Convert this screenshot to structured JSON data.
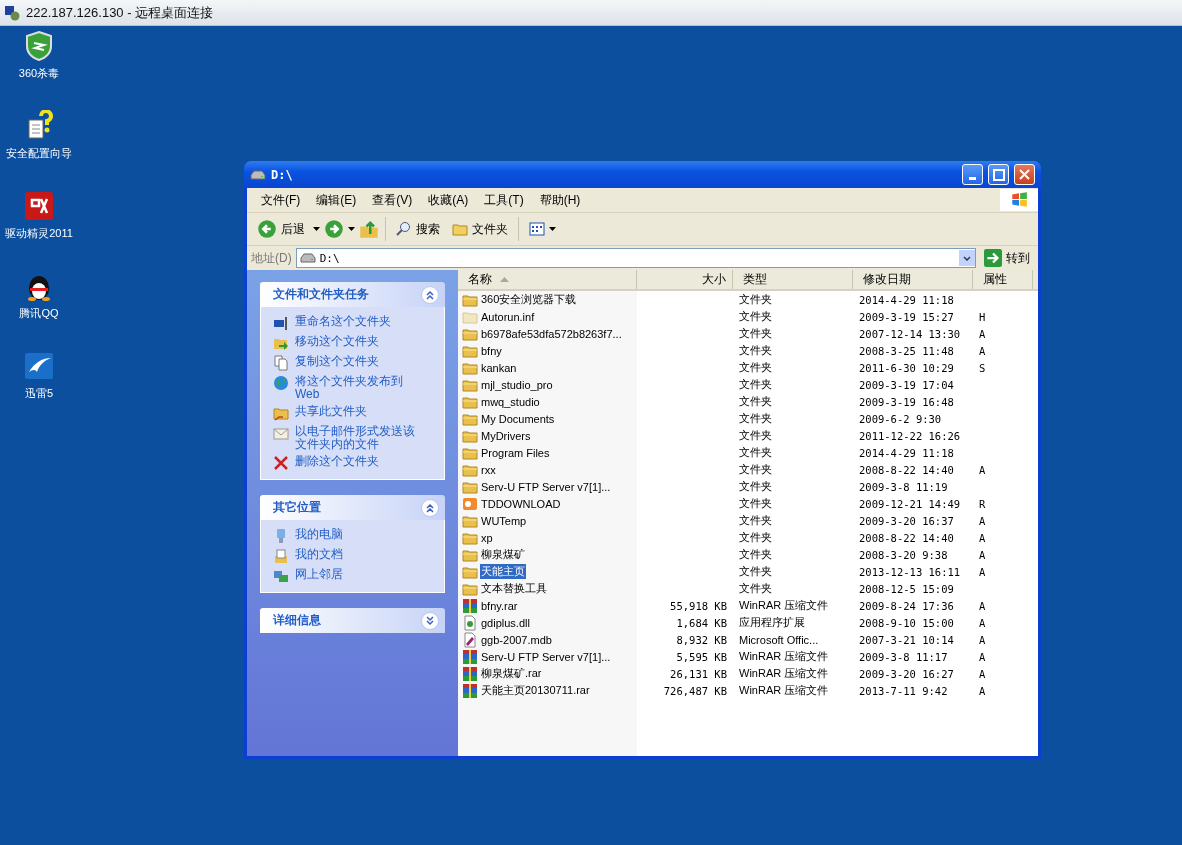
{
  "rdp_title": "222.187.126.130 - 远程桌面连接",
  "desktop_icons": [
    {
      "label": "360杀毒",
      "kind": "shield"
    },
    {
      "label": "安全配置向导",
      "kind": "help"
    },
    {
      "label": "驱动精灵2011",
      "kind": "driver"
    },
    {
      "label": "腾讯QQ",
      "kind": "penguin"
    },
    {
      "label": "迅雷5",
      "kind": "bird"
    }
  ],
  "window": {
    "title": "D:\\",
    "menu": [
      "文件(F)",
      "编辑(E)",
      "查看(V)",
      "收藏(A)",
      "工具(T)",
      "帮助(H)"
    ],
    "toolbar": {
      "back": "后退",
      "search": "搜索",
      "folders": "文件夹"
    },
    "address": {
      "label": "地址(D)",
      "value": "D:\\",
      "go": "转到"
    },
    "sidebar": [
      {
        "title": "文件和文件夹任务",
        "expanded": true,
        "items": [
          {
            "label": "重命名这个文件夹",
            "kind": "rename"
          },
          {
            "label": "移动这个文件夹",
            "kind": "move"
          },
          {
            "label": "复制这个文件夹",
            "kind": "copy"
          },
          {
            "label": "将这个文件夹发布到 Web",
            "kind": "web"
          },
          {
            "label": "共享此文件夹",
            "kind": "share"
          },
          {
            "label": "以电子邮件形式发送该文件夹内的文件",
            "kind": "mail"
          },
          {
            "label": "删除这个文件夹",
            "kind": "delete"
          }
        ]
      },
      {
        "title": "其它位置",
        "expanded": true,
        "items": [
          {
            "label": "我的电脑",
            "kind": "computer"
          },
          {
            "label": "我的文档",
            "kind": "documents"
          },
          {
            "label": "网上邻居",
            "kind": "network"
          }
        ]
      },
      {
        "title": "详细信息",
        "expanded": false
      }
    ],
    "columns": [
      {
        "label": "名称",
        "sorted": true
      },
      {
        "label": "大小",
        "sorted": false
      },
      {
        "label": "类型",
        "sorted": false
      },
      {
        "label": "修改日期",
        "sorted": false
      },
      {
        "label": "属性",
        "sorted": false
      }
    ],
    "rows": [
      {
        "kind": "folder",
        "name": "360安全浏览器下载",
        "type": "文件夹",
        "date": "2014-4-29 11:18",
        "selected": false
      },
      {
        "kind": "hidden-folder",
        "name": "Autorun.inf",
        "type": "文件夹",
        "date": "2009-3-19 15:27",
        "attr": "H",
        "selected": false
      },
      {
        "kind": "folder",
        "name": "b6978afe53dfa572b8263f7...",
        "type": "文件夹",
        "date": "2007-12-14 13:30",
        "attr": "A",
        "selected": false
      },
      {
        "kind": "folder",
        "name": "bfny",
        "type": "文件夹",
        "date": "2008-3-25 11:48",
        "attr": "A",
        "selected": false
      },
      {
        "kind": "folder",
        "name": "kankan",
        "type": "文件夹",
        "date": "2011-6-30 10:29",
        "attr": "S",
        "selected": false
      },
      {
        "kind": "folder",
        "name": "mjl_studio_pro",
        "type": "文件夹",
        "date": "2009-3-19 17:04",
        "selected": false
      },
      {
        "kind": "folder",
        "name": "mwq_studio",
        "type": "文件夹",
        "date": "2009-3-19 16:48",
        "selected": false
      },
      {
        "kind": "folder",
        "name": "My Documents",
        "type": "文件夹",
        "date": "2009-6-2 9:30",
        "selected": false
      },
      {
        "kind": "folder",
        "name": "MyDrivers",
        "type": "文件夹",
        "date": "2011-12-22 16:26",
        "selected": false
      },
      {
        "kind": "folder",
        "name": "Program Files",
        "type": "文件夹",
        "date": "2014-4-29 11:18",
        "selected": false
      },
      {
        "kind": "folder",
        "name": "rxx",
        "type": "文件夹",
        "date": "2008-8-22 14:40",
        "attr": "A",
        "selected": false
      },
      {
        "kind": "folder",
        "name": "Serv-U FTP Server v7[1]...",
        "type": "文件夹",
        "date": "2009-3-8 11:19",
        "selected": false
      },
      {
        "kind": "app-folder",
        "name": "TDDOWNLOAD",
        "type": "文件夹",
        "date": "2009-12-21 14:49",
        "attr": "R",
        "selected": false
      },
      {
        "kind": "folder",
        "name": "WUTemp",
        "type": "文件夹",
        "date": "2009-3-20 16:37",
        "attr": "A",
        "selected": false
      },
      {
        "kind": "folder",
        "name": "xp",
        "type": "文件夹",
        "date": "2008-8-22 14:40",
        "attr": "A",
        "selected": false
      },
      {
        "kind": "folder",
        "name": "柳泉煤矿",
        "type": "文件夹",
        "date": "2008-3-20 9:38",
        "attr": "A",
        "selected": false
      },
      {
        "kind": "folder",
        "name": "天能主页",
        "type": "文件夹",
        "date": "2013-12-13 16:11",
        "attr": "A",
        "selected": true
      },
      {
        "kind": "folder",
        "name": "文本替换工具",
        "type": "文件夹",
        "date": "2008-12-5 15:09",
        "selected": false
      },
      {
        "kind": "rar",
        "name": "bfny.rar",
        "size": "55,918 KB",
        "type": "WinRAR 压缩文件",
        "date": "2009-8-24 17:36",
        "attr": "A",
        "selected": false
      },
      {
        "kind": "dll",
        "name": "gdiplus.dll",
        "size": "1,684 KB",
        "type": "应用程序扩展",
        "date": "2008-9-10 15:00",
        "attr": "A",
        "selected": false
      },
      {
        "kind": "mdb",
        "name": "ggb-2007.mdb",
        "size": "8,932 KB",
        "type": "Microsoft Offic...",
        "date": "2007-3-21 10:14",
        "attr": "A",
        "selected": false
      },
      {
        "kind": "rar",
        "name": "Serv-U FTP Server v7[1]...",
        "size": "5,595 KB",
        "type": "WinRAR 压缩文件",
        "date": "2009-3-8 11:17",
        "attr": "A",
        "selected": false
      },
      {
        "kind": "rar",
        "name": "柳泉煤矿.rar",
        "size": "26,131 KB",
        "type": "WinRAR 压缩文件",
        "date": "2009-3-20 16:27",
        "attr": "A",
        "selected": false
      },
      {
        "kind": "rar",
        "name": "天能主页20130711.rar",
        "size": "726,487 KB",
        "type": "WinRAR 压缩文件",
        "date": "2013-7-11 9:42",
        "attr": "A",
        "selected": false
      }
    ]
  }
}
